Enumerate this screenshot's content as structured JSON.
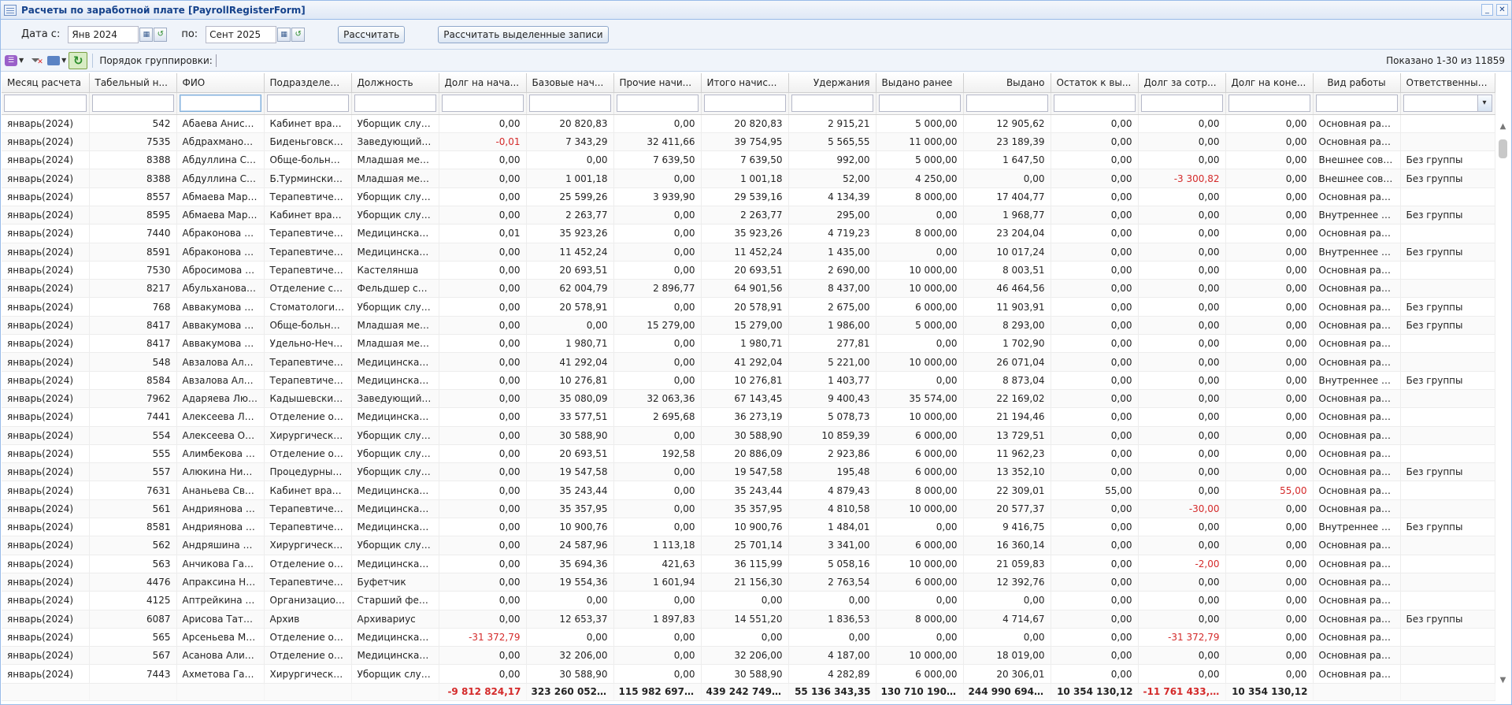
{
  "window": {
    "title": "Расчеты по заработной плате [PayrollRegisterForm]",
    "minimize": "_",
    "close": "✕"
  },
  "params": {
    "date_from_label": "Дата с:",
    "date_from": "Янв 2024",
    "date_to_label": "по:",
    "date_to": "Сент 2025",
    "calculate": "Рассчитать",
    "calculate_selected": "Рассчитать выделенные записи"
  },
  "toolbar": {
    "grouping_label": "Порядок группировки:",
    "shown": "Показано 1-30 из 11859",
    "icons": [
      "columns-menu-icon",
      "clear-filter-icon",
      "print-icon",
      "refresh-icon"
    ]
  },
  "columns": [
    "Месяц расчета",
    "Табельный н...",
    "ФИО",
    "Подразделение",
    "Должность",
    "Долг на нача...",
    "Базовые нач...",
    "Прочие начи...",
    "Итого начис...",
    "Удержания",
    "Выдано ранее",
    "Выдано",
    "Остаток к вы...",
    "Долг за сотр...",
    "Долг на коне...",
    "Вид работы",
    "Ответственный..."
  ],
  "rows": [
    [
      "январь(2024)",
      "542",
      "Абаева Аниса А...",
      "Кабинет врача ...",
      "Уборщик служе...",
      "0,00",
      "20 820,83",
      "0,00",
      "20 820,83",
      "2 915,21",
      "5 000,00",
      "12 905,62",
      "0,00",
      "0,00",
      "0,00",
      "Основная работа",
      ""
    ],
    [
      "январь(2024)",
      "7535",
      "Абдрахманова ...",
      "Биденьговский ...",
      "Заведующий Ф...",
      "-0,01",
      "7 343,29",
      "32 411,66",
      "39 754,95",
      "5 565,55",
      "11 000,00",
      "23 189,39",
      "0,00",
      "0,00",
      "0,00",
      "Основная работа",
      ""
    ],
    [
      "январь(2024)",
      "8388",
      "Абдуллина Сир...",
      "Обще-больнич...",
      "Младшая меди...",
      "0,00",
      "0,00",
      "7 639,50",
      "7 639,50",
      "992,00",
      "5 000,00",
      "1 647,50",
      "0,00",
      "0,00",
      "0,00",
      "Внешнее совме...",
      "Без группы"
    ],
    [
      "январь(2024)",
      "8388",
      "Абдуллина Сир...",
      "Б.Турминский ...",
      "Младшая меди...",
      "0,00",
      "1 001,18",
      "0,00",
      "1 001,18",
      "52,00",
      "4 250,00",
      "0,00",
      "0,00",
      "-3 300,82",
      "0,00",
      "Внешнее совме...",
      "Без группы"
    ],
    [
      "январь(2024)",
      "8557",
      "Абмаева Марин...",
      "Терапевтическ...",
      "Уборщик служе...",
      "0,00",
      "25 599,26",
      "3 939,90",
      "29 539,16",
      "4 134,39",
      "8 000,00",
      "17 404,77",
      "0,00",
      "0,00",
      "0,00",
      "Основная работа",
      ""
    ],
    [
      "январь(2024)",
      "8595",
      "Абмаева Марин...",
      "Кабинет врача ...",
      "Уборщик служе...",
      "0,00",
      "2 263,77",
      "0,00",
      "2 263,77",
      "295,00",
      "0,00",
      "1 968,77",
      "0,00",
      "0,00",
      "0,00",
      "Внутреннее сов...",
      "Без группы"
    ],
    [
      "январь(2024)",
      "7440",
      "Абраконова Ел...",
      "Терапевтическ...",
      "Медицинская с...",
      "0,01",
      "35 923,26",
      "0,00",
      "35 923,26",
      "4 719,23",
      "8 000,00",
      "23 204,04",
      "0,00",
      "0,00",
      "0,00",
      "Основная работа",
      ""
    ],
    [
      "январь(2024)",
      "8591",
      "Абраконова Ел...",
      "Терапевтическ...",
      "Медицинская с...",
      "0,00",
      "11 452,24",
      "0,00",
      "11 452,24",
      "1 435,00",
      "0,00",
      "10 017,24",
      "0,00",
      "0,00",
      "0,00",
      "Внутреннее сов...",
      "Без группы"
    ],
    [
      "январь(2024)",
      "7530",
      "Абросимова Ма...",
      "Терапевтическ...",
      "Кастелянша",
      "0,00",
      "20 693,51",
      "0,00",
      "20 693,51",
      "2 690,00",
      "10 000,00",
      "8 003,51",
      "0,00",
      "0,00",
      "0,00",
      "Основная работа",
      ""
    ],
    [
      "январь(2024)",
      "8217",
      "Абульханова Гу...",
      "Отделение ско...",
      "Фельдшер скор...",
      "0,00",
      "62 004,79",
      "2 896,77",
      "64 901,56",
      "8 437,00",
      "10 000,00",
      "46 464,56",
      "0,00",
      "0,00",
      "0,00",
      "Основная работа",
      ""
    ],
    [
      "январь(2024)",
      "768",
      "Аввакумова Га...",
      "Стоматологиче...",
      "Уборщик служе...",
      "0,00",
      "20 578,91",
      "0,00",
      "20 578,91",
      "2 675,00",
      "6 000,00",
      "11 903,91",
      "0,00",
      "0,00",
      "0,00",
      "Основная работа",
      "Без группы"
    ],
    [
      "январь(2024)",
      "8417",
      "Аввакумова На...",
      "Обще-больнич...",
      "Младшая меди...",
      "0,00",
      "0,00",
      "15 279,00",
      "15 279,00",
      "1 986,00",
      "5 000,00",
      "8 293,00",
      "0,00",
      "0,00",
      "0,00",
      "Основная работа",
      "Без группы"
    ],
    [
      "январь(2024)",
      "8417",
      "Аввакумова На...",
      "Удельно-Нечас...",
      "Младшая меди...",
      "0,00",
      "1 980,71",
      "0,00",
      "1 980,71",
      "277,81",
      "0,00",
      "1 702,90",
      "0,00",
      "0,00",
      "0,00",
      "Основная работа",
      ""
    ],
    [
      "январь(2024)",
      "548",
      "Авзалова Альб...",
      "Терапевтическ...",
      "Медицинская с...",
      "0,00",
      "41 292,04",
      "0,00",
      "41 292,04",
      "5 221,00",
      "10 000,00",
      "26 071,04",
      "0,00",
      "0,00",
      "0,00",
      "Основная работа",
      ""
    ],
    [
      "январь(2024)",
      "8584",
      "Авзалова Альб...",
      "Терапевтическ...",
      "Медицинская с...",
      "0,00",
      "10 276,81",
      "0,00",
      "10 276,81",
      "1 403,77",
      "0,00",
      "8 873,04",
      "0,00",
      "0,00",
      "0,00",
      "Внутреннее сов...",
      "Без группы"
    ],
    [
      "январь(2024)",
      "7962",
      "Адаряева Люд...",
      "Кадышевский ...",
      "Заведующий Ф...",
      "0,00",
      "35 080,09",
      "32 063,36",
      "67 143,45",
      "9 400,43",
      "35 574,00",
      "22 169,02",
      "0,00",
      "0,00",
      "0,00",
      "Основная работа",
      ""
    ],
    [
      "январь(2024)",
      "7441",
      "Алексеева Лид...",
      "Отделение общ...",
      "Медицинская с...",
      "0,00",
      "33 577,51",
      "2 695,68",
      "36 273,19",
      "5 078,73",
      "10 000,00",
      "21 194,46",
      "0,00",
      "0,00",
      "0,00",
      "Основная работа",
      ""
    ],
    [
      "январь(2024)",
      "554",
      "Алексеева Ольг...",
      "Хирургическое ...",
      "Уборщик служе...",
      "0,00",
      "30 588,90",
      "0,00",
      "30 588,90",
      "10 859,39",
      "6 000,00",
      "13 729,51",
      "0,00",
      "0,00",
      "0,00",
      "Основная работа",
      ""
    ],
    [
      "январь(2024)",
      "555",
      "Алимбекова Ру...",
      "Отделение общ...",
      "Уборщик служе...",
      "0,00",
      "20 693,51",
      "192,58",
      "20 886,09",
      "2 923,86",
      "6 000,00",
      "11 962,23",
      "0,00",
      "0,00",
      "0,00",
      "Основная работа",
      ""
    ],
    [
      "январь(2024)",
      "557",
      "Алюкина Нина ...",
      "Процедурный к...",
      "Уборщик служе...",
      "0,00",
      "19 547,58",
      "0,00",
      "19 547,58",
      "195,48",
      "6 000,00",
      "13 352,10",
      "0,00",
      "0,00",
      "0,00",
      "Основная работа",
      "Без группы"
    ],
    [
      "январь(2024)",
      "7631",
      "Ананьева Свет...",
      "Кабинет врача ...",
      "Медицинская с...",
      "0,00",
      "35 243,44",
      "0,00",
      "35 243,44",
      "4 879,43",
      "8 000,00",
      "22 309,01",
      "55,00",
      "0,00",
      "55,00",
      "Основная работа",
      ""
    ],
    [
      "январь(2024)",
      "561",
      "Андриянова Та...",
      "Терапевтическ...",
      "Медицинская с...",
      "0,00",
      "35 357,95",
      "0,00",
      "35 357,95",
      "4 810,58",
      "10 000,00",
      "20 577,37",
      "0,00",
      "-30,00",
      "0,00",
      "Основная работа",
      ""
    ],
    [
      "январь(2024)",
      "8581",
      "Андриянова Та...",
      "Терапевтическ...",
      "Медицинская с...",
      "0,00",
      "10 900,76",
      "0,00",
      "10 900,76",
      "1 484,01",
      "0,00",
      "9 416,75",
      "0,00",
      "0,00",
      "0,00",
      "Внутреннее сов...",
      "Без группы"
    ],
    [
      "январь(2024)",
      "562",
      "Андряшина Ол...",
      "Хирургическое ...",
      "Уборщик служе...",
      "0,00",
      "24 587,96",
      "1 113,18",
      "25 701,14",
      "3 341,00",
      "6 000,00",
      "16 360,14",
      "0,00",
      "0,00",
      "0,00",
      "Основная работа",
      ""
    ],
    [
      "январь(2024)",
      "563",
      "Анчикова Гали...",
      "Отделение общ...",
      "Медицинская с...",
      "0,00",
      "35 694,36",
      "421,63",
      "36 115,99",
      "5 058,16",
      "10 000,00",
      "21 059,83",
      "0,00",
      "-2,00",
      "0,00",
      "Основная работа",
      ""
    ],
    [
      "январь(2024)",
      "4476",
      "Апраксина Нат...",
      "Терапевтическ...",
      "Буфетчик",
      "0,00",
      "19 554,36",
      "1 601,94",
      "21 156,30",
      "2 763,54",
      "6 000,00",
      "12 392,76",
      "0,00",
      "0,00",
      "0,00",
      "Основная работа",
      ""
    ],
    [
      "январь(2024)",
      "4125",
      "Аптрейкина Ол...",
      "Организационн...",
      "Старший фельд...",
      "0,00",
      "0,00",
      "0,00",
      "0,00",
      "0,00",
      "0,00",
      "0,00",
      "0,00",
      "0,00",
      "0,00",
      "Основная работа",
      ""
    ],
    [
      "январь(2024)",
      "6087",
      "Арисова Татьян...",
      "Архив",
      "Архивариус",
      "0,00",
      "12 653,37",
      "1 897,83",
      "14 551,20",
      "1 836,53",
      "8 000,00",
      "4 714,67",
      "0,00",
      "0,00",
      "0,00",
      "Основная работа",
      "Без группы"
    ],
    [
      "январь(2024)",
      "565",
      "Арсеньева Мар...",
      "Отделение общ...",
      "Медицинская с...",
      "-31 372,79",
      "0,00",
      "0,00",
      "0,00",
      "0,00",
      "0,00",
      "0,00",
      "0,00",
      "-31 372,79",
      "0,00",
      "Основная работа",
      ""
    ],
    [
      "январь(2024)",
      "567",
      "Асанова Алия И...",
      "Отделение орг...",
      "Медицинская с...",
      "0,00",
      "32 206,00",
      "0,00",
      "32 206,00",
      "4 187,00",
      "10 000,00",
      "18 019,00",
      "0,00",
      "0,00",
      "0,00",
      "Основная работа",
      ""
    ],
    [
      "январь(2024)",
      "7443",
      "Ахметова Гали...",
      "Хирургическое ...",
      "Уборщик служе...",
      "0,00",
      "30 588,90",
      "0,00",
      "30 588,90",
      "4 282,89",
      "6 000,00",
      "20 306,01",
      "0,00",
      "0,00",
      "0,00",
      "Основная работа",
      ""
    ]
  ],
  "totals": [
    "-9 812 824,17",
    "323 260 052,33",
    "115 982 697,14",
    "439 242 749,47",
    "55 136 343,35",
    "130 710 190,89",
    "244 990 694,49",
    "10 354 130,12",
    "-11 761 433,55",
    "10 354 130,12"
  ],
  "colors": {
    "negative": "#d42a2a",
    "accent": "#15428b",
    "header_border": "#99bbe8"
  }
}
